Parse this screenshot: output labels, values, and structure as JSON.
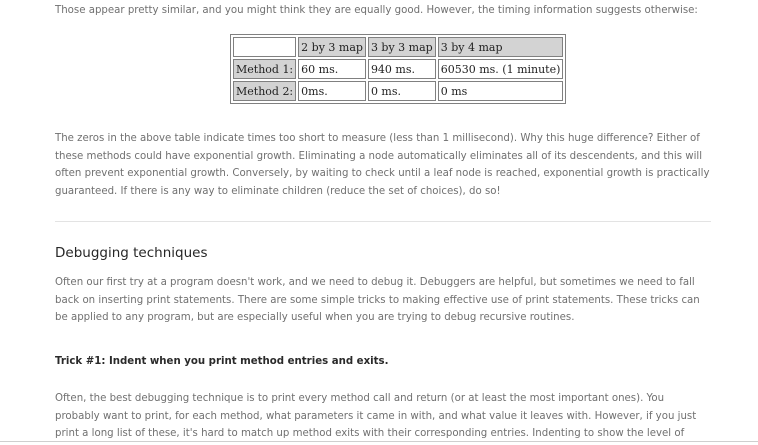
{
  "intro_text": "Those appear pretty similar, and you might think they are equally good. However, the timing information suggests otherwise:",
  "table": {
    "headers": [
      "",
      "2 by 3 map",
      "3 by 3 map",
      "3 by 4 map"
    ],
    "rows": [
      {
        "label": "Method 1:",
        "cells": [
          "60 ms.",
          "940 ms.",
          "60530 ms. (1 minute)"
        ]
      },
      {
        "label": "Method 2:",
        "cells": [
          "0ms.",
          "0 ms.",
          "0 ms"
        ]
      }
    ]
  },
  "zeros_paragraph": "The zeros in the above table indicate times too short to measure (less than 1 millisecond). Why this huge difference? Either of these methods could have exponential growth. Eliminating a node automatically eliminates all of its descendents, and this will often prevent exponential growth. Conversely, by waiting to check until a leaf node is reached, exponential growth is practically guaranteed. If there is any way to eliminate children (reduce the set of choices), do so!",
  "section_heading": "Debugging techniques",
  "debug_paragraph": "Often our first try at a program doesn't work, and we need to debug it. Debuggers are helpful, but sometimes we need to fall back on inserting print statements. There are some simple tricks to making effective use of print statements. These tricks can be applied to any program, but are especially useful when you are trying to debug recursive routines.",
  "trick_heading": "Trick #1: Indent when you print method entries and exits.",
  "often_paragraph": "Often, the best debugging technique is to print every method call and return (or at least the most important ones). You probably want to print, for each method, what parameters it came in with, and what value it leaves with. However, if you just print a long list of these, it's hard to match up method exits with their corresponding entries. Indenting to show the level of nesting can help."
}
